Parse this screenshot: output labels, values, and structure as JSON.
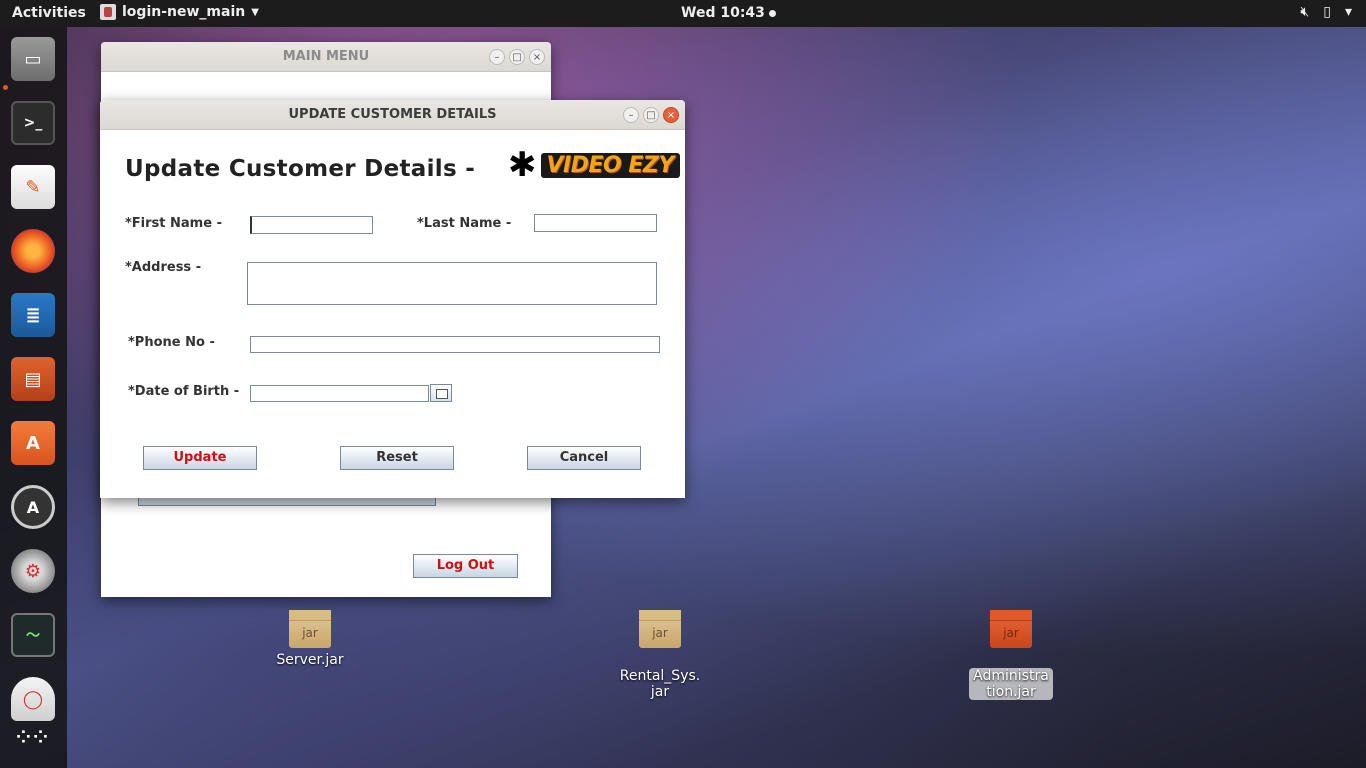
{
  "topbar": {
    "activities": "Activities",
    "app_name": "login-new_main",
    "clock": "Wed 10:43"
  },
  "dock": {
    "items": [
      "files-icon",
      "terminal-icon",
      "text-editor-icon",
      "firefox-icon",
      "writer-icon",
      "impress-icon",
      "software-center-icon",
      "updater-icon",
      "settings-icon",
      "system-monitor-icon",
      "optical-drive-icon",
      "show-apps-icon"
    ]
  },
  "main_menu": {
    "title": "MAIN MENU",
    "logout_label": "Log Out"
  },
  "update_window": {
    "title": "UPDATE CUSTOMER DETAILS",
    "heading": "Update Customer Details -",
    "logo_text": "VIDEO EZY",
    "first_name_label": "*First Name -",
    "first_name_value": "",
    "last_name_label": "*Last Name -",
    "last_name_value": "",
    "address_label": "*Address -",
    "address_value": "",
    "phone_label": "*Phone No -",
    "phone_value": "",
    "dob_label": "*Date of Birth -",
    "dob_value": "",
    "update_label": "Update",
    "reset_label": "Reset",
    "cancel_label": "Cancel"
  },
  "desktop": {
    "icons": [
      {
        "name": "Server.jar",
        "glyph": "jar"
      },
      {
        "name": "Rental_Sys.\njar",
        "glyph": "jar"
      },
      {
        "name": "Administra\ntion.jar",
        "glyph": "jar",
        "selected": true
      }
    ]
  },
  "colors": {
    "accent_red": "#cc1111",
    "ubuntu_orange": "#e95420"
  }
}
